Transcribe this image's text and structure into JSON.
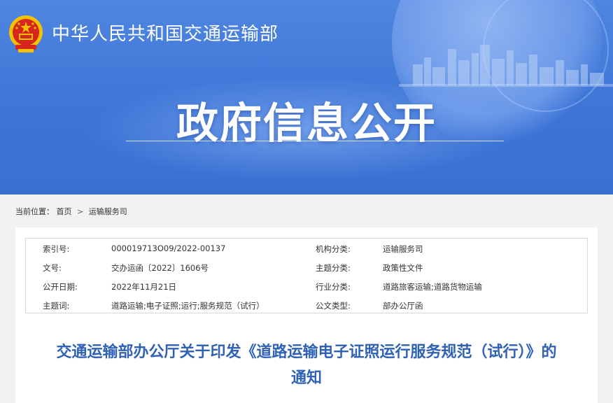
{
  "header": {
    "ministry_name": "中华人民共和国交通运输部",
    "banner_title": "政府信息公开"
  },
  "breadcrumb": {
    "label": "当前位置：",
    "items": [
      "首页",
      "运输服务司"
    ],
    "separator": ">"
  },
  "meta": {
    "rows": [
      {
        "k1": "索引号:",
        "v1": "000019713O09/2022-00137",
        "k2": "机构分类:",
        "v2": "运输服务司"
      },
      {
        "k1": "文号:",
        "v1": "交办运函〔2022〕1606号",
        "k2": "主题分类:",
        "v2": "政策性文件"
      },
      {
        "k1": "公开日期:",
        "v1": "2022年11月21日",
        "k2": "行业分类:",
        "v2": "道路旅客运输;道路货物运输"
      },
      {
        "k1": "主题词:",
        "v1": "道路运输;电子证照;运行;服务规范（试行）",
        "k2": "公文类型:",
        "v2": "部办公厅函"
      }
    ]
  },
  "document": {
    "title_line1": "交通运输部办公厅关于印发《道路运输电子证照运行服务规范（试行）》的",
    "title_line2": "通知"
  },
  "colors": {
    "banner_blue": "#3d74d6",
    "title_blue": "#2f62b4",
    "emblem_red": "#d7261e",
    "emblem_gold": "#f2c200"
  },
  "icons": {
    "emblem": "national-emblem-icon"
  }
}
